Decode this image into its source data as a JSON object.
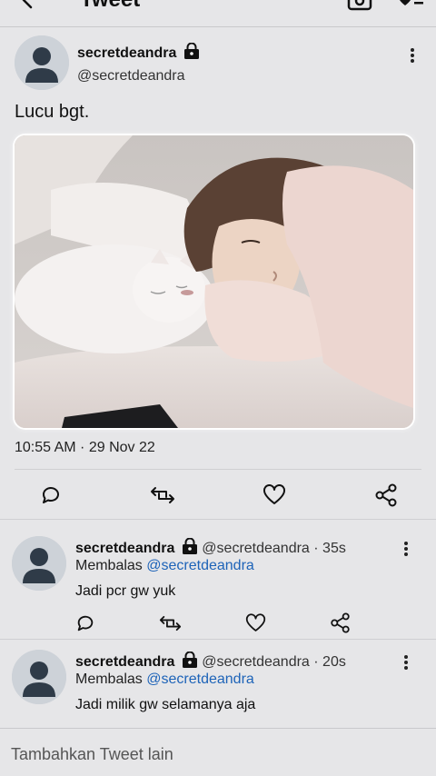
{
  "header": {
    "title": "Tweet"
  },
  "tweet": {
    "display_name": "secretdeandra",
    "handle": "@secretdeandra",
    "text": "Lucu bgt.",
    "timestamp": "10:55 AM · 29 Nov 22"
  },
  "replies": [
    {
      "display_name": "secretdeandra",
      "meta": "@secretdeandra · 35s",
      "replying_prefix": "Membalas",
      "replying_to": "@secretdeandra",
      "text": "Jadi pcr gw yuk"
    },
    {
      "display_name": "secretdeandra",
      "meta": "@secretdeandra · 20s",
      "replying_prefix": "Membalas",
      "replying_to": "@secretdeandra",
      "text": "Jadi milik gw selamanya aja"
    }
  ],
  "composer": {
    "placeholder": "Tambahkan Tweet lain"
  },
  "colors": {
    "background": "#e6e6e8",
    "link": "#1d63b8",
    "text": "#111111"
  },
  "icons": {
    "back": "arrow-left-icon",
    "camera": "camera-icon",
    "list": "list-icon",
    "lock": "lock-icon",
    "more": "more-vertical-icon",
    "reply": "comment-icon",
    "retweet": "retweet-icon",
    "like": "heart-icon",
    "share": "share-icon"
  }
}
